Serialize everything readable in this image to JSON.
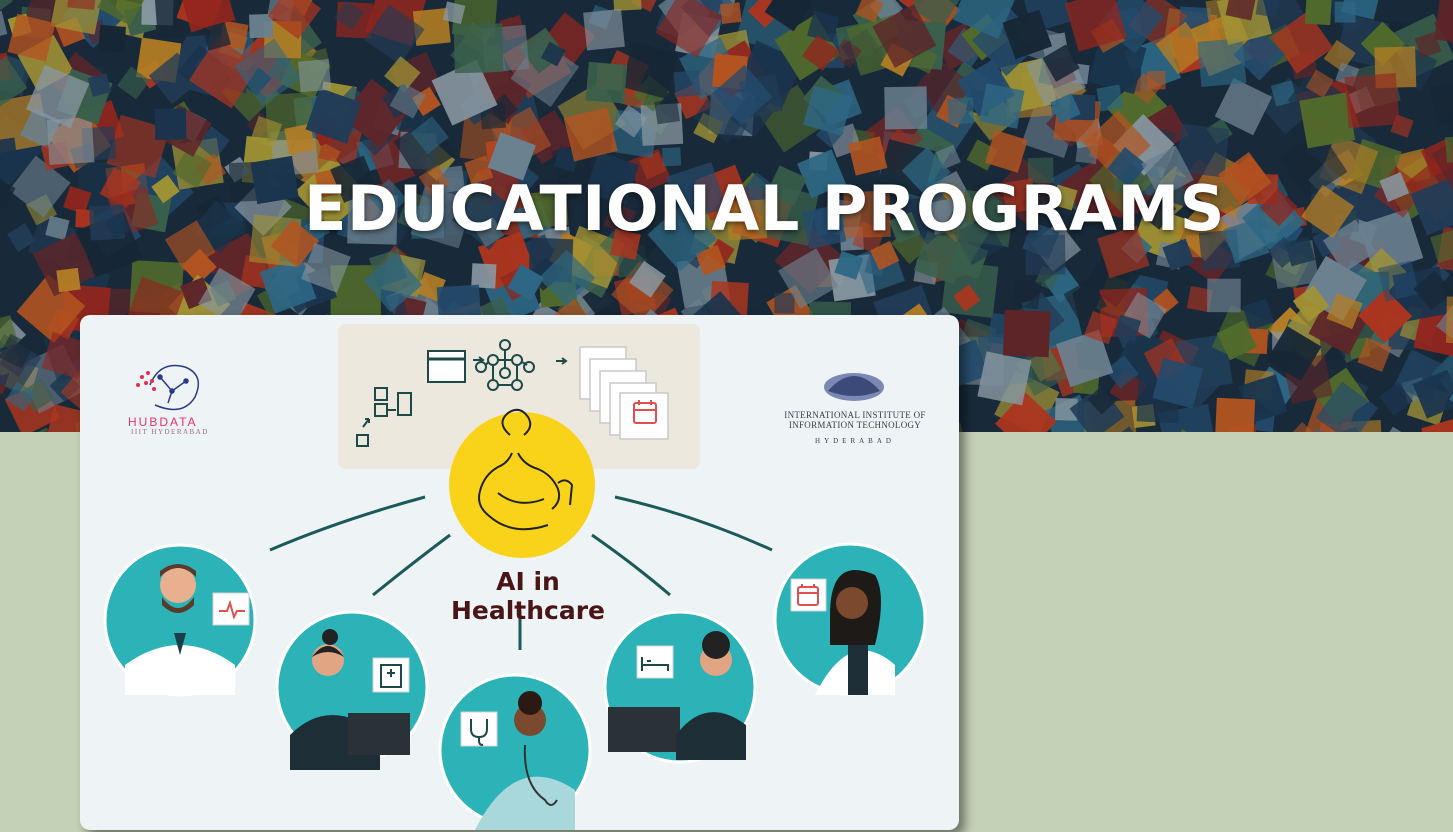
{
  "hero": {
    "title": "EDUCATIONAL PROGRAMS"
  },
  "banner": {
    "label": "AI in Healthcare",
    "hub_logo_text": "HUBDATA",
    "hub_logo_subtext": "IIIT HYDERABAD",
    "iiit_logo_name": "INTERNATIONAL INSTITUTE OF INFORMATION TECHNOLOGY",
    "iiit_logo_city": "HYDERABAD"
  },
  "colors": {
    "page_background": "#c4d1b6",
    "card_background": "#eef3f6",
    "teal": "#2bb3b8",
    "yellow": "#f9d31a",
    "connector": "#1c5a5a",
    "label": "#4a1515"
  },
  "icons": [
    "heartbeat-icon",
    "hospital-icon",
    "stethoscope-icon",
    "patient-bed-icon",
    "calendar-icon",
    "neural-network-icon"
  ]
}
